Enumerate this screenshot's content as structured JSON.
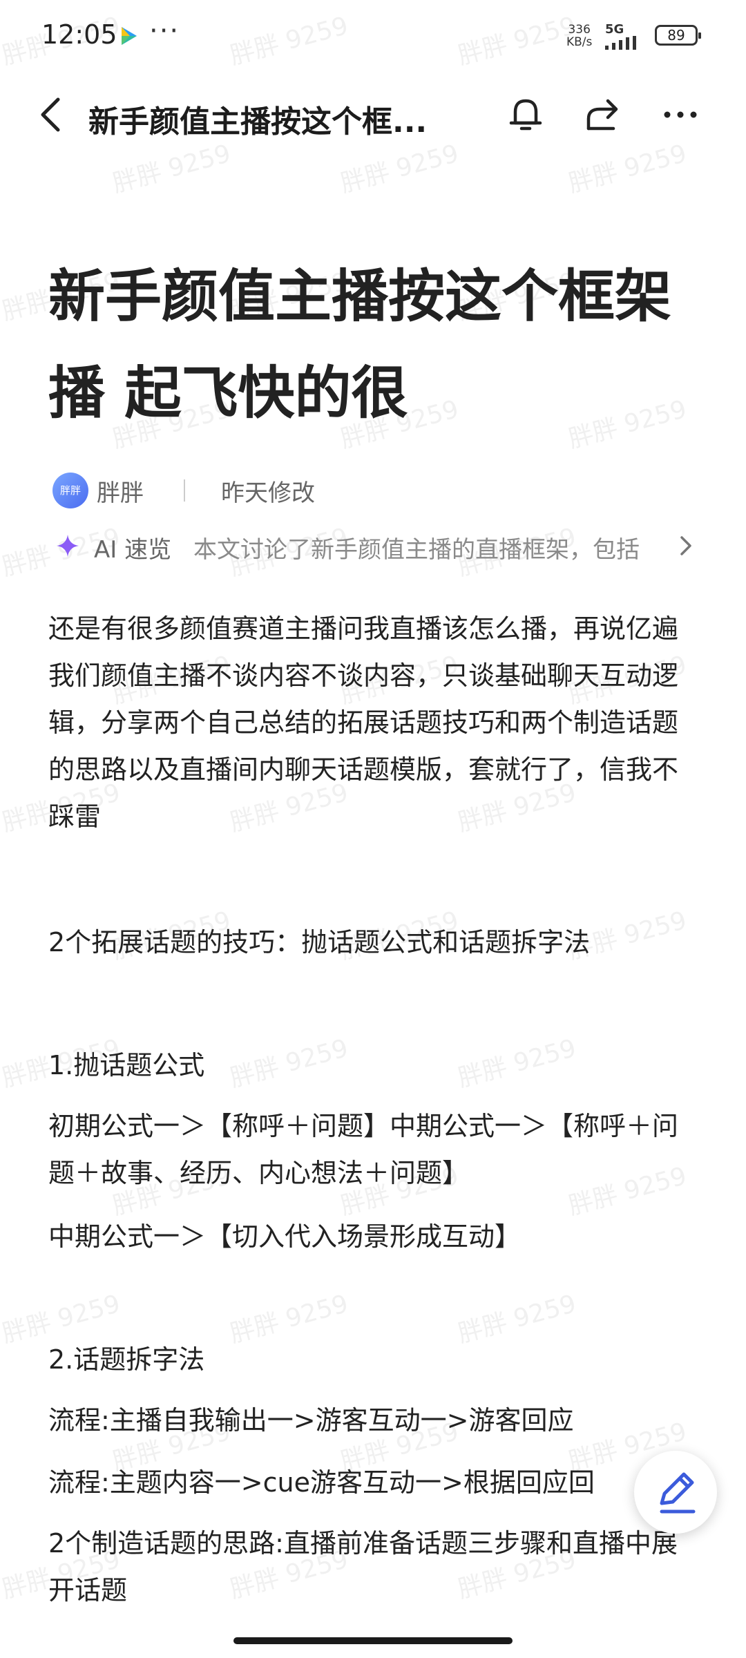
{
  "status_bar": {
    "time": "12:05",
    "more": "···",
    "speed": "336",
    "speed_unit": "KB/s",
    "network": "5G",
    "battery": "89"
  },
  "header": {
    "title": "新手颜值主播按这个框...",
    "icons": [
      "back-icon",
      "bell-icon",
      "share-icon",
      "more-icon"
    ]
  },
  "article": {
    "title": "新手颜值主播按这个框架播 起飞快的很",
    "author": "胖胖",
    "avatar_text": "胖胖",
    "modified": "昨天修改",
    "ai": {
      "label": "AI 速览",
      "summary": "本文讨论了新手颜值主播的直播框架，包括"
    },
    "paragraphs": [
      "还是有很多颜值赛道主播问我直播该怎么播，再说亿遍我们颜值主播不谈内容不谈内容，只谈基础聊天互动逻辑，分享两个自己总结的拓展话题技巧和两个制造话题的思路以及直播间内聊天话题模版，套就行了，信我不踩雷",
      "2个拓展话题的技巧：抛话题公式和话题拆字法",
      "1.抛话题公式",
      "初期公式一＞【称呼＋问题】中期公式一＞【称呼＋问题＋故事、经历、内心想法＋问题】",
      "中期公式一＞【切入代入场景形成互动】",
      "2.话题拆字法",
      "流程:主播自我输出一>游客互动一>游客回应",
      "流程:主题内容一>cue游客互动一>根据回应回",
      "2个制造话题的思路:直播前准备话题三步骤和直播中展开话题"
    ]
  },
  "watermark": "胖胖 9259",
  "colors": {
    "accent": "#3b5bdb",
    "ai_star": "#8b5cf6",
    "text": "#222222",
    "muted": "#666666"
  }
}
